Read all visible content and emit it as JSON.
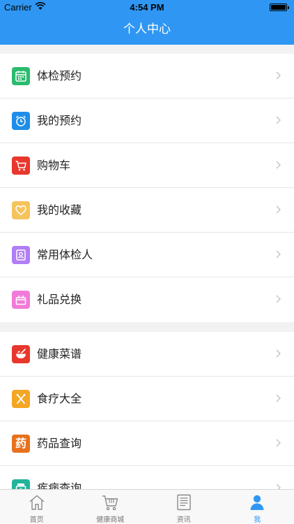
{
  "status_bar": {
    "carrier": "Carrier",
    "time": "4:54 PM"
  },
  "nav": {
    "title": "个人中心"
  },
  "groups": [
    {
      "items": [
        {
          "label": "体检预约",
          "icon": "calendar-icon",
          "color": "#2bbb6f"
        },
        {
          "label": "我的预约",
          "icon": "alarm-clock-icon",
          "color": "#1e8ee9"
        },
        {
          "label": "购物车",
          "icon": "cart-icon",
          "color": "#e8372c"
        },
        {
          "label": "我的收藏",
          "icon": "heart-icon",
          "color": "#f5c45c"
        },
        {
          "label": "常用体检人",
          "icon": "contact-icon",
          "color": "#b07ef5"
        },
        {
          "label": "礼品兑换",
          "icon": "gift-icon",
          "color": "#f27bd9"
        }
      ]
    },
    {
      "items": [
        {
          "label": "健康菜谱",
          "icon": "bowl-icon",
          "color": "#e8372c"
        },
        {
          "label": "食疗大全",
          "icon": "cutlery-icon",
          "color": "#f5a623"
        },
        {
          "label": "药品查询",
          "icon": "medicine-icon",
          "color": "#e8711c",
          "glyph": "药"
        },
        {
          "label": "疾病查询",
          "icon": "disease-icon",
          "color": "#22b59a"
        }
      ]
    }
  ],
  "tabbar": [
    {
      "label": "首页",
      "icon": "home-icon",
      "active": false
    },
    {
      "label": "健康商城",
      "icon": "cart-icon",
      "active": false
    },
    {
      "label": "资讯",
      "icon": "news-icon",
      "active": false
    },
    {
      "label": "我",
      "icon": "person-icon",
      "active": true
    }
  ],
  "colors": {
    "primary": "#2f97f3",
    "tab_inactive": "#777777"
  }
}
